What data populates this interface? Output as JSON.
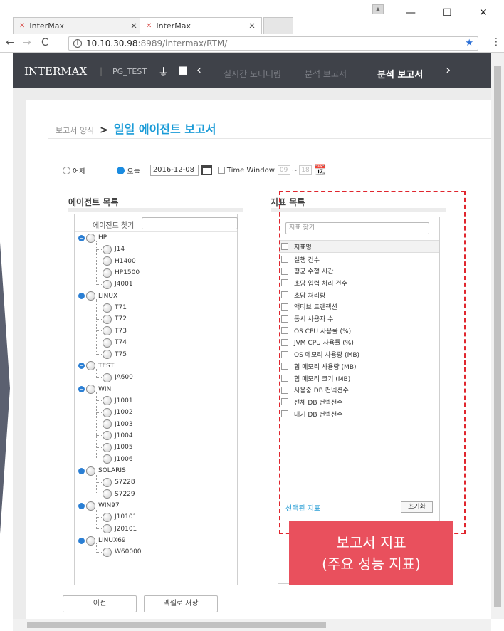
{
  "browser": {
    "tabs": [
      {
        "title": "InterMax",
        "favicon": "intermax-favicon"
      },
      {
        "title": "InterMax",
        "favicon": "intermax-favicon"
      }
    ],
    "url_host": "10.10.30.98",
    "url_path": ":8989/intermax/RTM/"
  },
  "header": {
    "brand": "INTERMAX",
    "separator": "|",
    "instance": "PG_TEST",
    "menus": [
      "실시간 모니터링",
      "분석 보고서",
      "분석 보고서"
    ]
  },
  "breadcrumb": {
    "parent": "보고서 양식",
    "arrow": ">",
    "title": "일일 에이전트 보고서"
  },
  "dateFilter": {
    "yesterday": "어제",
    "today": "오늘",
    "date": "2016-12-08",
    "timeWindowLabel": "Time Window",
    "startHour": "09",
    "tilde": "~",
    "endHour": "18"
  },
  "agents": {
    "title": "에이전트 목록",
    "searchLabel": "에이전트 찾기",
    "tree": [
      {
        "name": "HP",
        "children": [
          "J14",
          "H1400",
          "HP1500",
          "J4001"
        ]
      },
      {
        "name": "LINUX",
        "children": [
          "T71",
          "T72",
          "T73",
          "T74",
          "T75"
        ]
      },
      {
        "name": "TEST",
        "children": [
          "JA600"
        ]
      },
      {
        "name": "WIN",
        "children": [
          "J1001",
          "J1002",
          "J1003",
          "J1004",
          "J1005",
          "J1006"
        ]
      },
      {
        "name": "SOLARIS",
        "children": [
          "S7228",
          "S7229"
        ]
      },
      {
        "name": "WIN97",
        "children": [
          "J10101",
          "J20101"
        ]
      },
      {
        "name": "LINUX69",
        "children": [
          "W60000"
        ]
      }
    ]
  },
  "metrics": {
    "title": "지표 목록",
    "searchPlaceholder": "지표 찾기",
    "columnHeader": "지표명",
    "items": [
      "실행 건수",
      "평균 수행 시간",
      "초당 입력 처리 건수",
      "초당 처리량",
      "액티브 트랜잭션",
      "동시 사용자 수",
      "OS CPU 사용률 (%)",
      "JVM CPU 사용률 (%)",
      "OS 메모리 사용량 (MB)",
      "힙 메모리 사용량 (MB)",
      "힙 메모리 크기 (MB)",
      "사용중 DB 컨넥션수",
      "전체 DB 컨넥션수",
      "대기 DB 컨넥션수"
    ],
    "selectedLabel": "선택된 지표",
    "resetLabel": "초기화"
  },
  "callout": {
    "line1": "보고서 지표",
    "line2": "(주요 성능 지표)",
    "color": "#e9505d"
  },
  "buttons": {
    "prev": "이전",
    "excel": "엑셀로 저장"
  }
}
